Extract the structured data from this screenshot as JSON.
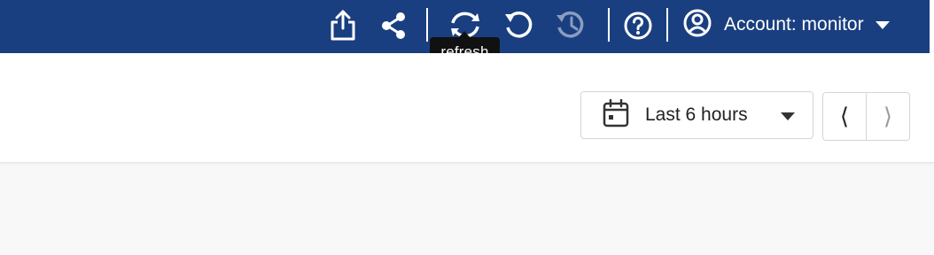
{
  "colors": {
    "topbar": "#1a3f80",
    "topbar_icon": "#ffffff",
    "disabled_icon": "#8a9cc0",
    "tooltip_bg": "#111111",
    "content_bg": "#f8f8f8"
  },
  "toolbar": {
    "icons": [
      {
        "name": "share-export-icon"
      },
      {
        "name": "share-icon"
      },
      {
        "name": "refresh-icon"
      },
      {
        "name": "reload-icon"
      },
      {
        "name": "history-icon",
        "disabled": true
      },
      {
        "name": "help-icon"
      },
      {
        "name": "account-icon"
      }
    ],
    "account_label": "Account: monitor",
    "tooltip": "refresh"
  },
  "time_range": {
    "icon": "calendar-icon",
    "label": "Last 6 hours"
  },
  "pager": {
    "prev_label": "⟨",
    "next_label": "⟩"
  }
}
